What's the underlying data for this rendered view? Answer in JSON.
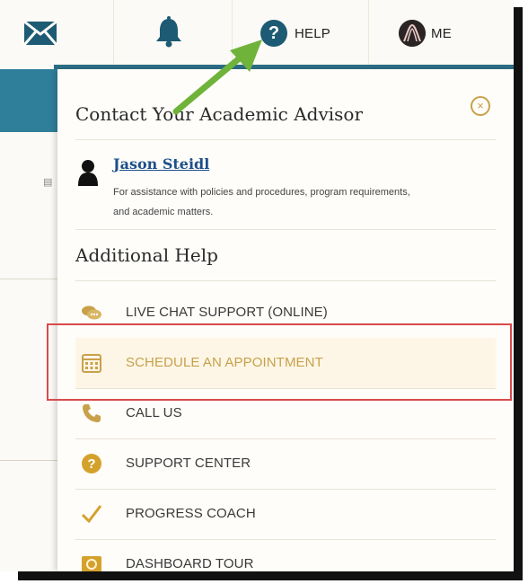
{
  "topbar": {
    "help_label": "HELP",
    "help_symbol": "?",
    "me_label": "ME",
    "icons": [
      "mail-icon",
      "bell-icon",
      "help-icon",
      "avatar"
    ]
  },
  "panel": {
    "title": "Contact Your Academic Advisor",
    "close_symbol": "×",
    "advisor": {
      "name": "Jason Steidl",
      "description": "For assistance with policies and procedures, program requirements, and academic matters."
    },
    "additional_title": "Additional Help",
    "items": [
      {
        "label": "LIVE CHAT SUPPORT (ONLINE)",
        "icon": "chat-icon"
      },
      {
        "label": "SCHEDULE AN APPOINTMENT",
        "icon": "calendar-icon"
      },
      {
        "label": "CALL US",
        "icon": "phone-icon"
      },
      {
        "label": "SUPPORT CENTER",
        "icon": "help-icon"
      },
      {
        "label": "PROGRESS COACH",
        "icon": "checkmark-icon"
      },
      {
        "label": "DASHBOARD TOUR",
        "icon": "tour-icon"
      }
    ]
  },
  "colors": {
    "accent_teal": "#2d6f86",
    "gold": "#c9a14a",
    "highlight_box": "#d94b4b",
    "arrow": "#6fb33a"
  }
}
